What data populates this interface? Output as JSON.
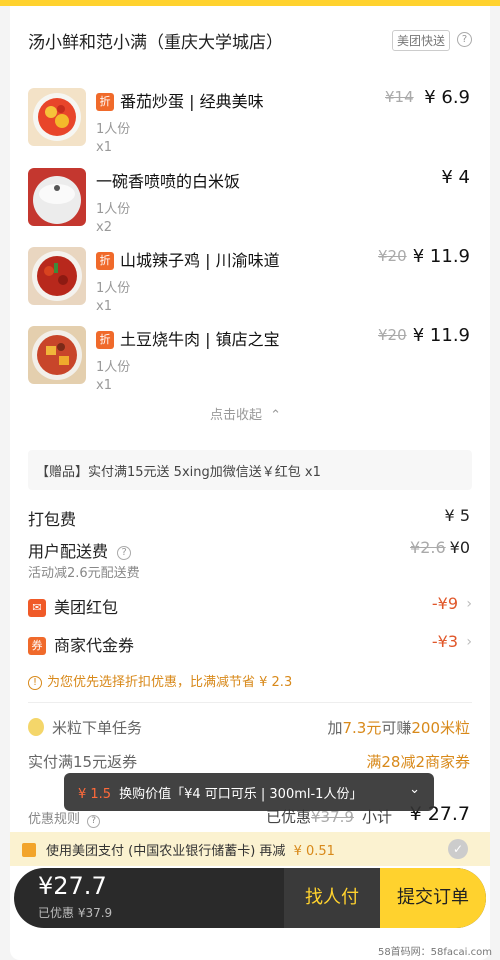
{
  "shop": {
    "name": "汤小鲜和范小满（重庆大学城店）",
    "tag": "美团快送",
    "help": "?"
  },
  "items": [
    {
      "discount_badge": "折",
      "name": "番茄炒蛋 | 经典美味",
      "portion": "1人份",
      "qty": "x1",
      "orig": "¥14",
      "price": "¥ 6.9"
    },
    {
      "discount_badge": "",
      "name": "一碗香喷喷的白米饭",
      "portion": "1人份",
      "qty": "x2",
      "orig": "",
      "price": "¥ 4"
    },
    {
      "discount_badge": "折",
      "name": "山城辣子鸡 | 川渝味道",
      "portion": "1人份",
      "qty": "x1",
      "orig": "¥20",
      "price": "¥ 11.9"
    },
    {
      "discount_badge": "折",
      "name": "土豆烧牛肉 | 镇店之宝",
      "portion": "1人份",
      "qty": "x1",
      "orig": "¥20",
      "price": "¥ 11.9"
    }
  ],
  "collapse_label": "点击收起",
  "gift_text": "【赠品】实付满15元送 5xing加微信送￥红包 x1",
  "fees": {
    "packing_label": "打包费",
    "packing_value": "¥ 5",
    "delivery_label": "用户配送费",
    "delivery_orig": "¥2.6",
    "delivery_value": "¥0",
    "delivery_note": "活动减2.6元配送费",
    "redpack_icon": "✉",
    "redpack_label": "美团红包",
    "redpack_value": "-¥9",
    "voucher_icon": "券",
    "voucher_label": "商家代金券",
    "voucher_value": "-¥3"
  },
  "tip": {
    "icon": "!",
    "text": "为您优先选择折扣优惠，比满减节省 ¥ 2.3"
  },
  "mission": {
    "label": "米粒下单任务",
    "prefix": "加",
    "amount": "7.3元",
    "mid": "可赚",
    "reward": "200米粒"
  },
  "rebate": {
    "label": "实付满15元返券",
    "value": "满28减2商家券"
  },
  "summary": {
    "rule_label": "优惠规则",
    "saved_label": "已优惠",
    "saved_value": "¥37.9",
    "subtotal_label": "小计",
    "subtotal_value": "¥ 27.7"
  },
  "toast": {
    "price": "¥ 1.5",
    "text": "换购价值「¥4 可口可乐 | 300ml-1人份」"
  },
  "pay_promo": {
    "text": "使用美团支付 (中国农业银行储蓄卡) 再减",
    "amount": "¥ 0.51"
  },
  "bottom": {
    "total": "¥27.7",
    "saved": "已优惠 ¥37.9",
    "find_label": "找人付",
    "submit_label": "提交订单"
  },
  "watermark": "58首码网：58facai.com",
  "colors": {
    "brand": "#ffd22e",
    "discount": "#f06a2b",
    "red": "#e0572a",
    "orange": "#d8891a"
  }
}
